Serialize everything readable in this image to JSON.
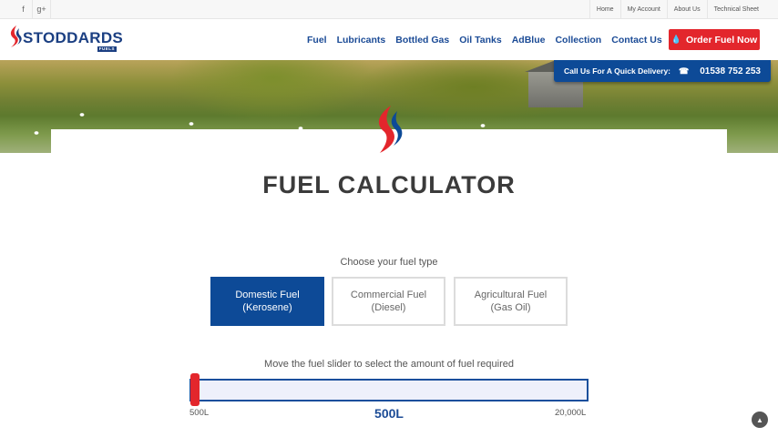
{
  "topbar": {
    "social": [
      {
        "icon": "facebook-icon",
        "glyph": "f"
      },
      {
        "icon": "google-plus-icon",
        "glyph": "g+"
      }
    ],
    "links": [
      "Home",
      "My Account",
      "About Us",
      "Technical Sheet"
    ]
  },
  "header": {
    "logo_text": "STODDARDS",
    "logo_sub": "FUELS",
    "nav": [
      "Fuel",
      "Lubricants",
      "Bottled Gas",
      "Oil Tanks",
      "AdBlue",
      "Collection",
      "Contact Us"
    ],
    "order_button": "Order Fuel Now",
    "order_icon": "flame-drop-icon"
  },
  "hero": {
    "call_text": "Call Us For A Quick Delivery:",
    "phone_icon": "phone-icon",
    "phone_number": "01538 752 253"
  },
  "calculator": {
    "title": "FUEL CALCULATOR",
    "choose_label": "Choose your fuel type",
    "options": [
      {
        "line1": "Domestic Fuel",
        "line2": "(Kerosene)",
        "selected": true
      },
      {
        "line1": "Commercial Fuel",
        "line2": "(Diesel)",
        "selected": false
      },
      {
        "line1": "Agricultural Fuel",
        "line2": "(Gas Oil)",
        "selected": false
      }
    ],
    "slider_label": "Move the fuel slider to select the amount of fuel required",
    "slider_min": "500L",
    "slider_max": "20,000L",
    "slider_value": "500L",
    "slider_position_fraction": 0
  },
  "colors": {
    "brand_blue": "#0d4a97",
    "nav_blue": "#1b4b96",
    "accent_red": "#e3262c"
  },
  "scroll_top_icon": "chevron-up-icon"
}
